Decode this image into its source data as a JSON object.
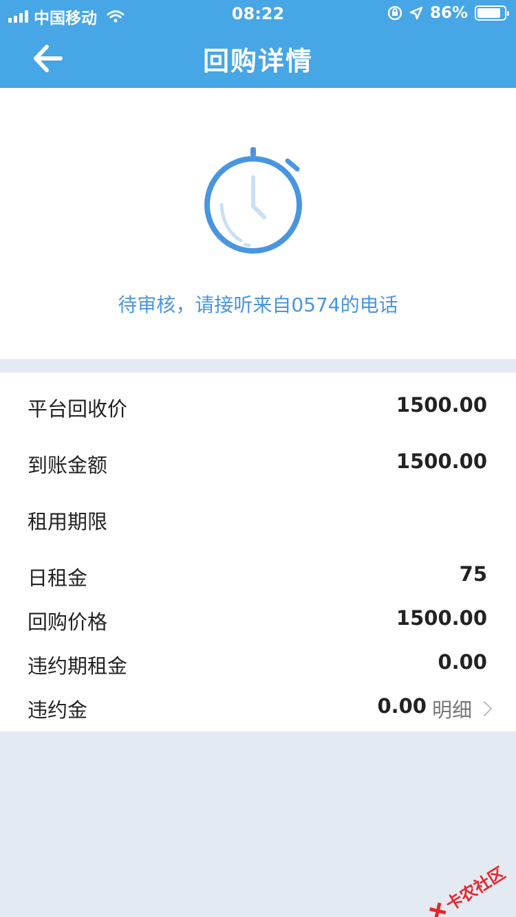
{
  "status_bar": {
    "carrier": "中国移动",
    "time": "08:22",
    "battery": "86%",
    "battery_level": 0.86
  },
  "nav": {
    "title": "回购详情",
    "back_icon": "arrow-left-icon"
  },
  "status": {
    "icon": "stopwatch-icon",
    "message": "待审核，请接听来自0574的电话"
  },
  "details": [
    {
      "label": "平台回收价",
      "value": "1500.00"
    },
    {
      "label": "到账金额",
      "value": "1500.00"
    },
    {
      "label": "租用期限",
      "value": ""
    },
    {
      "label": "日租金",
      "value": "75"
    },
    {
      "label": "回购价格",
      "value": "1500.00"
    },
    {
      "label": "违约期租金",
      "value": "0.00"
    },
    {
      "label": "违约金",
      "value": "0.00",
      "link": "明细"
    }
  ],
  "watermark": "卡农社区",
  "colors": {
    "header": "#46a6e6",
    "accent": "#4a95df",
    "background": "#e3eaf1"
  }
}
